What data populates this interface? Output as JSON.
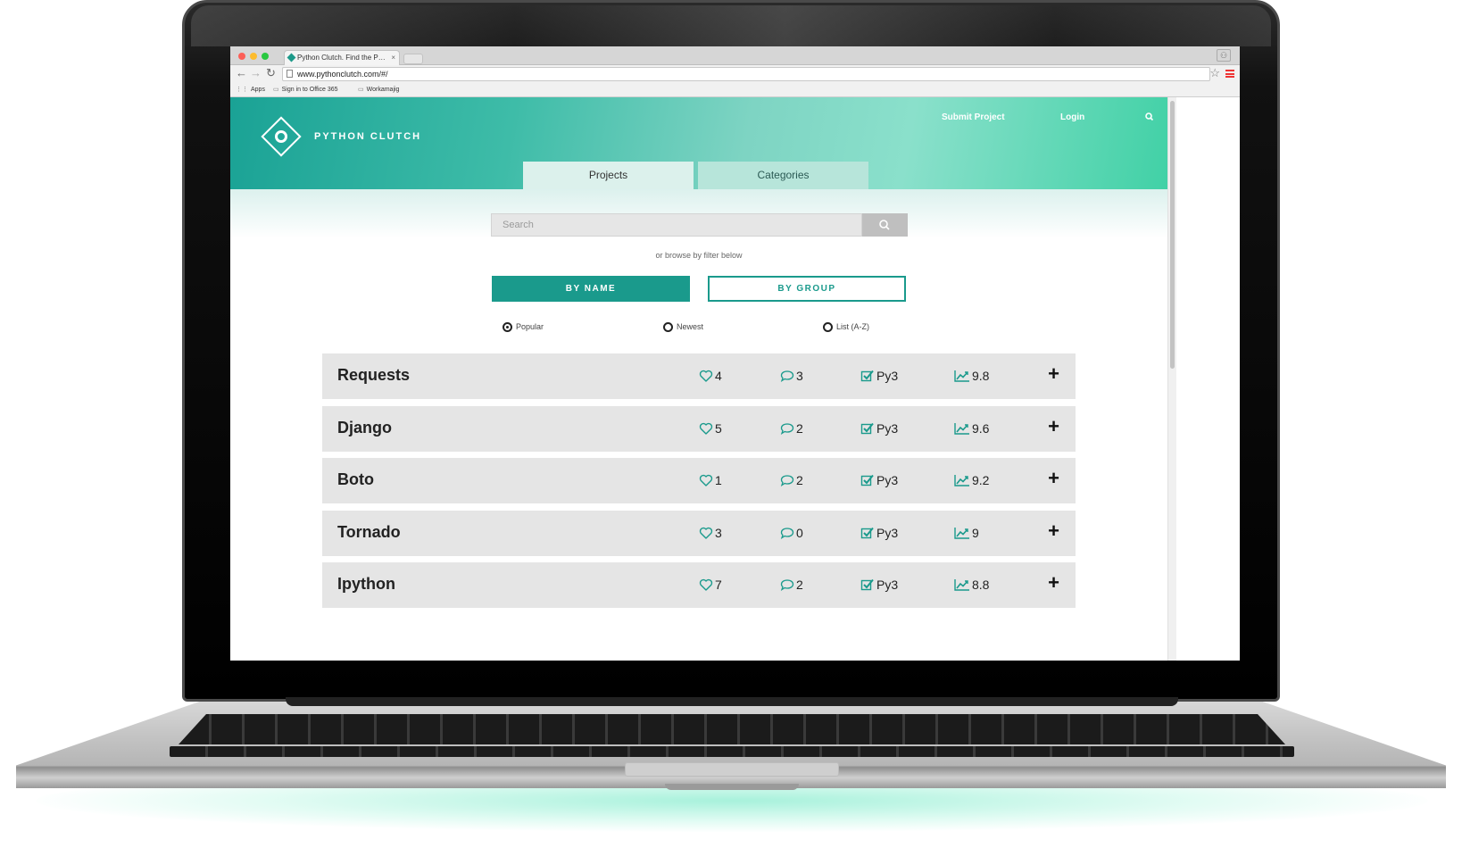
{
  "browser": {
    "tab_title": "Python Clutch. Find the P…",
    "url": "www.pythonclutch.com/#/",
    "bookmarks": [
      "Apps",
      "Sign in to Office 365",
      "Workamajig"
    ]
  },
  "header": {
    "brand": "PYTHON CLUTCH",
    "nav": {
      "submit": "Submit Project",
      "login": "Login"
    },
    "tabs": [
      "Projects",
      "Categories"
    ]
  },
  "search": {
    "placeholder": "Search",
    "hint": "or browse by filter below"
  },
  "filters": {
    "by_name": "BY NAME",
    "by_group": "BY GROUP",
    "sort": [
      "Popular",
      "Newest",
      "List (A-Z)"
    ],
    "selected_sort": "Popular"
  },
  "projects": [
    {
      "name": "Requests",
      "likes": "4",
      "comments": "3",
      "py3": "Py3",
      "score": "9.8"
    },
    {
      "name": "Django",
      "likes": "5",
      "comments": "2",
      "py3": "Py3",
      "score": "9.6"
    },
    {
      "name": "Boto",
      "likes": "1",
      "comments": "2",
      "py3": "Py3",
      "score": "9.2"
    },
    {
      "name": "Tornado",
      "likes": "3",
      "comments": "0",
      "py3": "Py3",
      "score": "9"
    },
    {
      "name": "Ipython",
      "likes": "7",
      "comments": "2",
      "py3": "Py3",
      "score": "8.8"
    }
  ],
  "colors": {
    "accent": "#1a9a8c",
    "row_bg": "#e5e5e5",
    "icon": "#1a9a8c"
  },
  "icons": [
    "heart-icon",
    "comment-icon",
    "checkbox-icon",
    "trend-icon",
    "plus-icon",
    "search-icon"
  ]
}
